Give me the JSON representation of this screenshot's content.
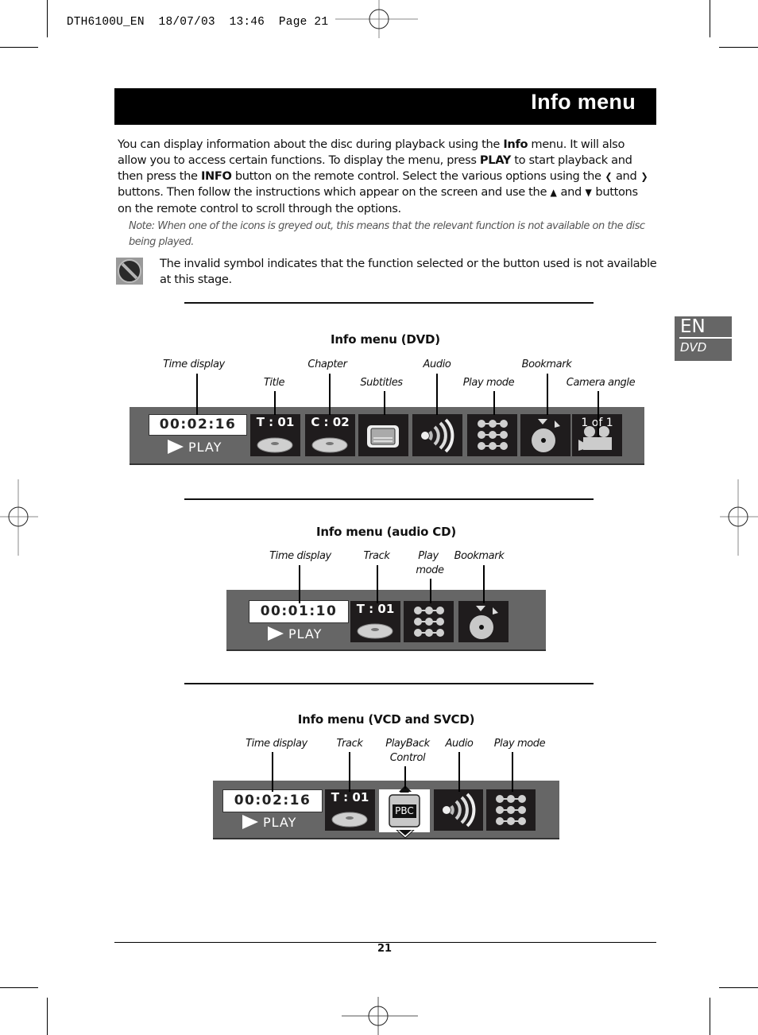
{
  "slug": {
    "doc_id": "DTH6100U_EN",
    "date": "18/07/03",
    "time": "13:46",
    "page_label": "Page 21"
  },
  "header": {
    "title": "Info menu"
  },
  "intro": {
    "p1_a": "You can display information about the disc during playback using the ",
    "p1_info": "Info",
    "p1_b": " menu. It will also allow you to access certain functions. To display the menu, press ",
    "p1_play": "PLAY",
    "p1_c": " to start playback and then press the ",
    "p1_info2": "INFO",
    "p1_d": " button on the remote control. Select the various options using the ",
    "left_arrow": "❮",
    "and1": " and ",
    "right_arrow": "❯",
    "p1_e": " buttons. Then follow the instructions which appear on the screen and use the ",
    "up_arrow": "▲",
    "and2": " and ",
    "down_arrow": "▼",
    "p1_f": " buttons on the remote control to scroll through the options."
  },
  "note": "Note: When one of the icons is greyed out, this means that the relevant function is not available on the disc being played.",
  "invalid": {
    "text": "The invalid symbol indicates that the function selected or the button used is not available at this stage."
  },
  "lang_tab": {
    "lang": "EN",
    "section": "DVD"
  },
  "sections": {
    "dvd": {
      "title": "Info menu (DVD)",
      "labels": {
        "time_display": "Time display",
        "title": "Title",
        "chapter": "Chapter",
        "subtitles": "Subtitles",
        "audio": "Audio",
        "play_mode": "Play mode",
        "bookmark": "Bookmark",
        "camera_angle": "Camera angle"
      },
      "time": "00:02:16",
      "status": "PLAY",
      "title_value": "T : 01",
      "chapter_value": "C : 02",
      "angle_value": "1 of 1"
    },
    "cd": {
      "title": "Info menu (audio CD)",
      "labels": {
        "time_display": "Time display",
        "track": "Track",
        "play_mode_1": "Play",
        "play_mode_2": "mode",
        "bookmark": "Bookmark"
      },
      "time": "00:01:10",
      "status": "PLAY",
      "track_value": "T : 01"
    },
    "vcd": {
      "title": "Info menu (VCD and SVCD)",
      "labels": {
        "time_display": "Time display",
        "track": "Track",
        "pbc_1": "PlayBack",
        "pbc_2": "Control",
        "audio": "Audio",
        "play_mode": "Play mode"
      },
      "time": "00:02:16",
      "status": "PLAY",
      "track_value": "T : 01",
      "pbc_value": "PBC"
    }
  },
  "footer": {
    "page_number": "21"
  },
  "colors": {
    "bar_grey": "#666666",
    "tile_dark": "#1f1c1d",
    "title_bar": "#000000"
  }
}
